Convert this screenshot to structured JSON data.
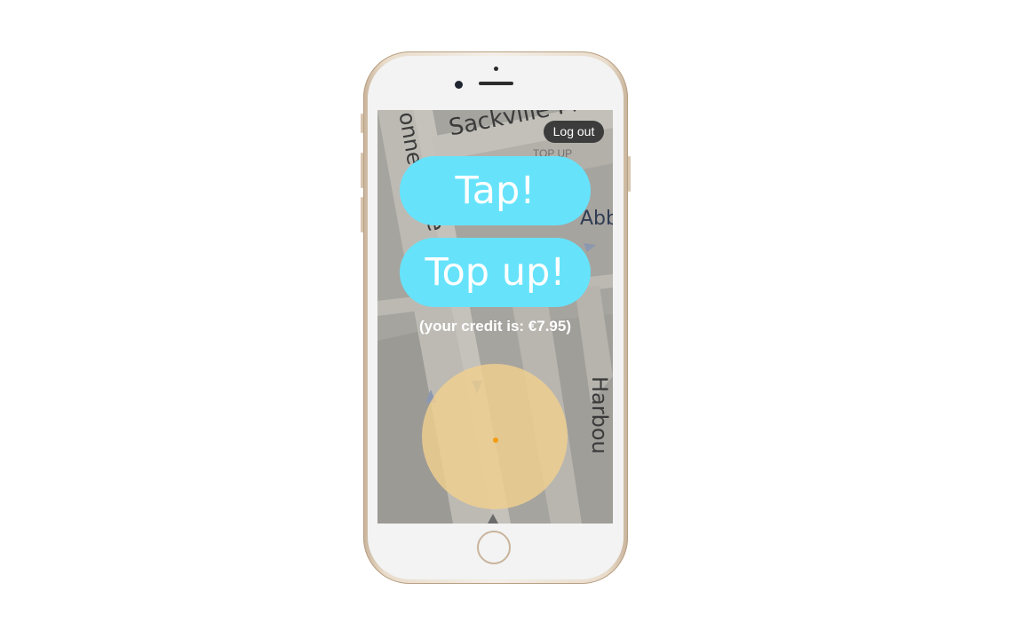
{
  "app": {
    "logout_label": "Log out",
    "tap_label": "Tap!",
    "topup_label": "Top up!",
    "topup_hint": "TOP UP",
    "credit_text": "(your credit is: €7.95)"
  },
  "map": {
    "street_labels": {
      "sackville": "Sackville Pl",
      "abbey": "Abb",
      "harbour": "Harbou",
      "oconnell": "onne",
      "lower": "e Lwr"
    },
    "accuracy_circle_color": "#f0cf8f",
    "location_dot_color": "#f39c12"
  },
  "theme": {
    "button_color": "#66e3fb",
    "logout_bg": "#3c3c3c"
  }
}
